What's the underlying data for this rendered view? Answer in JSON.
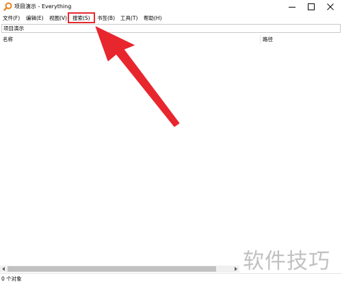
{
  "window": {
    "title": "项目演示 - Everything"
  },
  "menu": {
    "items": [
      "文件(F)",
      "编辑(E)",
      "视图(V)",
      "搜索(S)",
      "书签(B)",
      "工具(T)",
      "帮助(H)"
    ]
  },
  "search": {
    "value": "项目演示"
  },
  "columns": {
    "name": "名称",
    "path": "路径"
  },
  "status": {
    "text": "0 个对象"
  },
  "annotation": {
    "highlighted_menu": "搜索(S)",
    "color": "#e8262d"
  },
  "watermark": {
    "text": "软件技巧"
  },
  "colors": {
    "accent": "#e8262d",
    "app_icon": "#e8821e"
  },
  "icons": [
    "everything-magnifier-icon",
    "minimize-icon",
    "maximize-icon",
    "close-icon"
  ]
}
